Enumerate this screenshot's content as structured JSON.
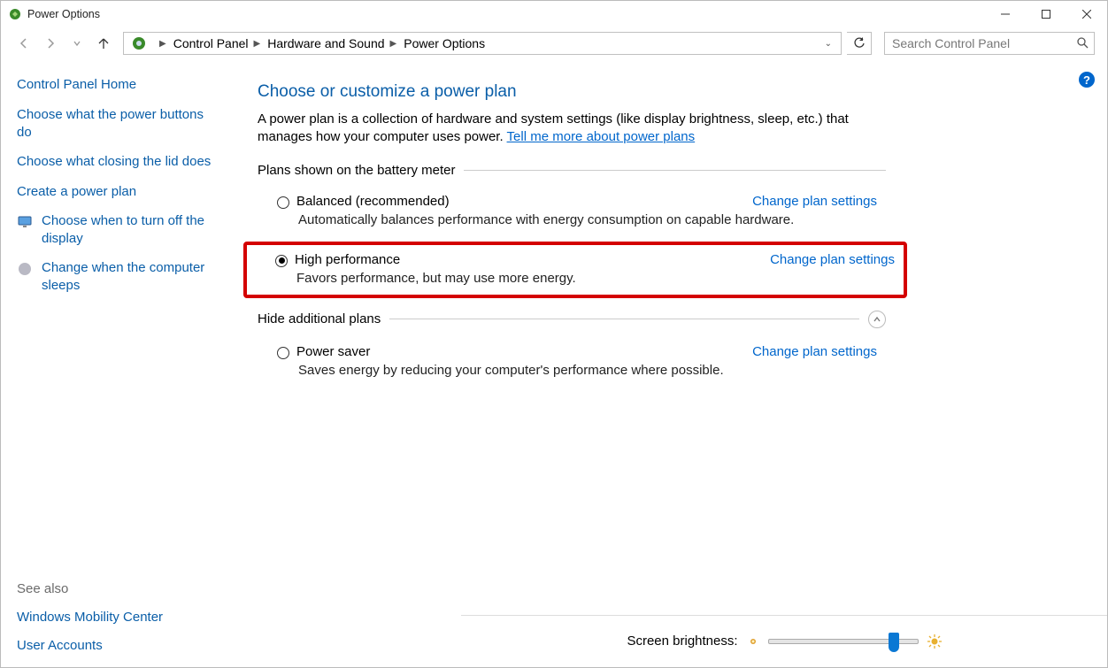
{
  "window": {
    "title": "Power Options"
  },
  "breadcrumbs": {
    "root": "Control Panel",
    "mid": "Hardware and Sound",
    "leaf": "Power Options"
  },
  "search": {
    "placeholder": "Search Control Panel"
  },
  "sidebar": {
    "home": "Control Panel Home",
    "links": [
      {
        "label": "Choose what the power buttons do"
      },
      {
        "label": "Choose what closing the lid does"
      },
      {
        "label": "Create a power plan"
      },
      {
        "label": "Choose when to turn off the display",
        "icon": "display-icon"
      },
      {
        "label": "Change when the computer sleeps",
        "icon": "moon-icon"
      }
    ],
    "see_also_label": "See also",
    "see_also": [
      {
        "label": "Windows Mobility Center"
      },
      {
        "label": "User Accounts"
      }
    ]
  },
  "main": {
    "heading": "Choose or customize a power plan",
    "desc_a": "A power plan is a collection of hardware and system settings (like display brightness, sleep, etc.) that manages how your computer uses power. ",
    "desc_link": "Tell me more about power plans",
    "section1": "Plans shown on the battery meter",
    "section2": "Hide additional plans",
    "change_link": "Change plan settings",
    "plans": [
      {
        "name": "Balanced (recommended)",
        "desc": "Automatically balances performance with energy consumption on capable hardware.",
        "selected": false
      },
      {
        "name": "High performance",
        "desc": "Favors performance, but may use more energy.",
        "selected": true,
        "highlighted": true
      },
      {
        "name": "Power saver",
        "desc": "Saves energy by reducing your computer's performance where possible.",
        "selected": false
      }
    ],
    "brightness_label": "Screen brightness:",
    "brightness_pct": 86
  }
}
